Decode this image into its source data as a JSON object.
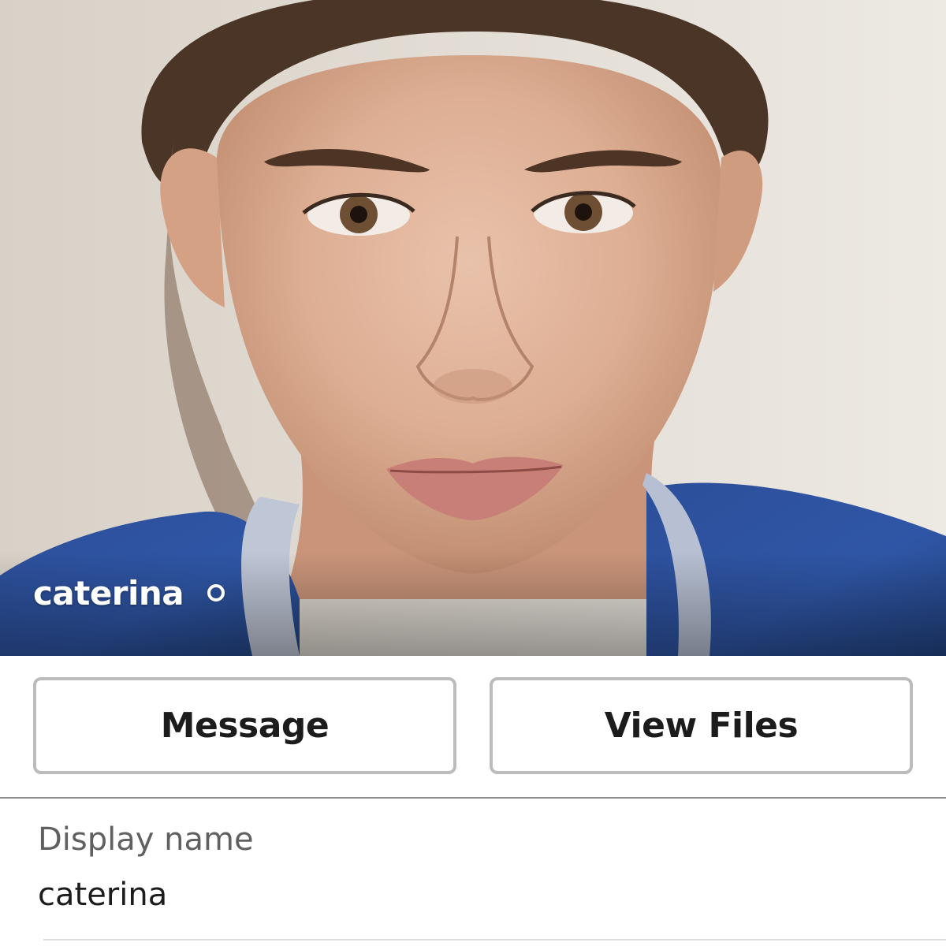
{
  "profile": {
    "name": "caterina",
    "presence": "away",
    "presence_icon": "presence-away-icon"
  },
  "actions": {
    "message_label": "Message",
    "view_files_label": "View Files"
  },
  "fields": {
    "display_name_label": "Display name",
    "display_name_value": "caterina"
  },
  "colors": {
    "text_primary": "#1d1c1d",
    "text_secondary": "#616061",
    "button_border": "#bcbcbc"
  }
}
